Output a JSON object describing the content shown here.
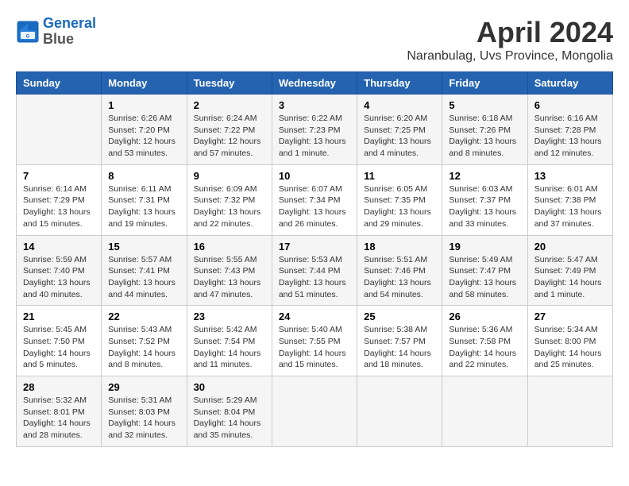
{
  "header": {
    "logo_line1": "General",
    "logo_line2": "Blue",
    "title": "April 2024",
    "subtitle": "Naranbulag, Uvs Province, Mongolia"
  },
  "days_of_week": [
    "Sunday",
    "Monday",
    "Tuesday",
    "Wednesday",
    "Thursday",
    "Friday",
    "Saturday"
  ],
  "weeks": [
    [
      {
        "day": "",
        "info": ""
      },
      {
        "day": "1",
        "info": "Sunrise: 6:26 AM\nSunset: 7:20 PM\nDaylight: 12 hours\nand 53 minutes."
      },
      {
        "day": "2",
        "info": "Sunrise: 6:24 AM\nSunset: 7:22 PM\nDaylight: 12 hours\nand 57 minutes."
      },
      {
        "day": "3",
        "info": "Sunrise: 6:22 AM\nSunset: 7:23 PM\nDaylight: 13 hours\nand 1 minute."
      },
      {
        "day": "4",
        "info": "Sunrise: 6:20 AM\nSunset: 7:25 PM\nDaylight: 13 hours\nand 4 minutes."
      },
      {
        "day": "5",
        "info": "Sunrise: 6:18 AM\nSunset: 7:26 PM\nDaylight: 13 hours\nand 8 minutes."
      },
      {
        "day": "6",
        "info": "Sunrise: 6:16 AM\nSunset: 7:28 PM\nDaylight: 13 hours\nand 12 minutes."
      }
    ],
    [
      {
        "day": "7",
        "info": "Sunrise: 6:14 AM\nSunset: 7:29 PM\nDaylight: 13 hours\nand 15 minutes."
      },
      {
        "day": "8",
        "info": "Sunrise: 6:11 AM\nSunset: 7:31 PM\nDaylight: 13 hours\nand 19 minutes."
      },
      {
        "day": "9",
        "info": "Sunrise: 6:09 AM\nSunset: 7:32 PM\nDaylight: 13 hours\nand 22 minutes."
      },
      {
        "day": "10",
        "info": "Sunrise: 6:07 AM\nSunset: 7:34 PM\nDaylight: 13 hours\nand 26 minutes."
      },
      {
        "day": "11",
        "info": "Sunrise: 6:05 AM\nSunset: 7:35 PM\nDaylight: 13 hours\nand 29 minutes."
      },
      {
        "day": "12",
        "info": "Sunrise: 6:03 AM\nSunset: 7:37 PM\nDaylight: 13 hours\nand 33 minutes."
      },
      {
        "day": "13",
        "info": "Sunrise: 6:01 AM\nSunset: 7:38 PM\nDaylight: 13 hours\nand 37 minutes."
      }
    ],
    [
      {
        "day": "14",
        "info": "Sunrise: 5:59 AM\nSunset: 7:40 PM\nDaylight: 13 hours\nand 40 minutes."
      },
      {
        "day": "15",
        "info": "Sunrise: 5:57 AM\nSunset: 7:41 PM\nDaylight: 13 hours\nand 44 minutes."
      },
      {
        "day": "16",
        "info": "Sunrise: 5:55 AM\nSunset: 7:43 PM\nDaylight: 13 hours\nand 47 minutes."
      },
      {
        "day": "17",
        "info": "Sunrise: 5:53 AM\nSunset: 7:44 PM\nDaylight: 13 hours\nand 51 minutes."
      },
      {
        "day": "18",
        "info": "Sunrise: 5:51 AM\nSunset: 7:46 PM\nDaylight: 13 hours\nand 54 minutes."
      },
      {
        "day": "19",
        "info": "Sunrise: 5:49 AM\nSunset: 7:47 PM\nDaylight: 13 hours\nand 58 minutes."
      },
      {
        "day": "20",
        "info": "Sunrise: 5:47 AM\nSunset: 7:49 PM\nDaylight: 14 hours\nand 1 minute."
      }
    ],
    [
      {
        "day": "21",
        "info": "Sunrise: 5:45 AM\nSunset: 7:50 PM\nDaylight: 14 hours\nand 5 minutes."
      },
      {
        "day": "22",
        "info": "Sunrise: 5:43 AM\nSunset: 7:52 PM\nDaylight: 14 hours\nand 8 minutes."
      },
      {
        "day": "23",
        "info": "Sunrise: 5:42 AM\nSunset: 7:54 PM\nDaylight: 14 hours\nand 11 minutes."
      },
      {
        "day": "24",
        "info": "Sunrise: 5:40 AM\nSunset: 7:55 PM\nDaylight: 14 hours\nand 15 minutes."
      },
      {
        "day": "25",
        "info": "Sunrise: 5:38 AM\nSunset: 7:57 PM\nDaylight: 14 hours\nand 18 minutes."
      },
      {
        "day": "26",
        "info": "Sunrise: 5:36 AM\nSunset: 7:58 PM\nDaylight: 14 hours\nand 22 minutes."
      },
      {
        "day": "27",
        "info": "Sunrise: 5:34 AM\nSunset: 8:00 PM\nDaylight: 14 hours\nand 25 minutes."
      }
    ],
    [
      {
        "day": "28",
        "info": "Sunrise: 5:32 AM\nSunset: 8:01 PM\nDaylight: 14 hours\nand 28 minutes."
      },
      {
        "day": "29",
        "info": "Sunrise: 5:31 AM\nSunset: 8:03 PM\nDaylight: 14 hours\nand 32 minutes."
      },
      {
        "day": "30",
        "info": "Sunrise: 5:29 AM\nSunset: 8:04 PM\nDaylight: 14 hours\nand 35 minutes."
      },
      {
        "day": "",
        "info": ""
      },
      {
        "day": "",
        "info": ""
      },
      {
        "day": "",
        "info": ""
      },
      {
        "day": "",
        "info": ""
      }
    ]
  ]
}
